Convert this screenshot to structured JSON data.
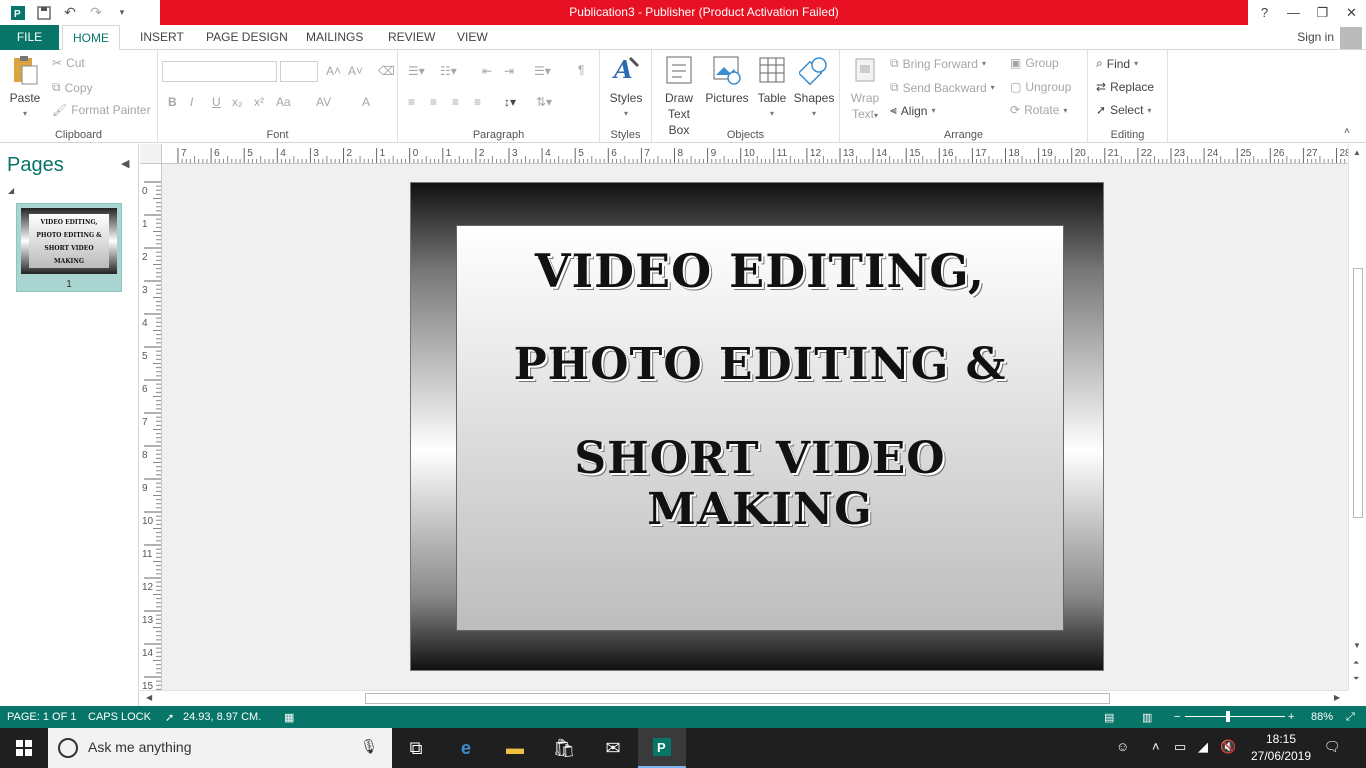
{
  "window": {
    "title": "Publication3 -  Publisher (Product Activation Failed)",
    "help": "?",
    "minimize": "—",
    "restore": "❐",
    "close": "✕",
    "ribbon_options": "?"
  },
  "qat": {
    "app_icon": "publisher-icon",
    "save": "save-icon",
    "undo": "undo-icon",
    "redo": "redo-icon",
    "customize": "customize-icon"
  },
  "tabs": [
    {
      "label": "FILE"
    },
    {
      "label": "HOME"
    },
    {
      "label": "INSERT"
    },
    {
      "label": "PAGE DESIGN"
    },
    {
      "label": "MAILINGS"
    },
    {
      "label": "REVIEW"
    },
    {
      "label": "VIEW"
    }
  ],
  "account": {
    "sign_in": "Sign in"
  },
  "ribbon": {
    "clipboard": {
      "label": "Clipboard",
      "paste": "Paste",
      "cut": "Cut",
      "copy": "Copy",
      "format_painter": "Format Painter"
    },
    "font": {
      "label": "Font",
      "bold": "B",
      "italic": "I",
      "underline": "U",
      "subscript": "x₂",
      "superscript": "x²",
      "case": "Aa",
      "spacing": "AV",
      "color": "A",
      "grow": "A˄",
      "shrink": "A˅"
    },
    "paragraph": {
      "label": "Paragraph",
      "pilcrow": "¶"
    },
    "styles": {
      "label": "Styles",
      "styles": "Styles"
    },
    "objects": {
      "label": "Objects",
      "draw_text_box": "Draw\nText Box",
      "draw_line1": "Draw",
      "draw_line2": "Text Box",
      "pictures": "Pictures",
      "table": "Table",
      "shapes": "Shapes"
    },
    "arrange": {
      "label": "Arrange",
      "wrap1": "Wrap",
      "wrap2": "Text",
      "bring_forward": "Bring Forward",
      "send_backward": "Send Backward",
      "align": "Align",
      "group": "Group",
      "ungroup": "Ungroup",
      "rotate": "Rotate"
    },
    "editing": {
      "label": "Editing",
      "find": "Find",
      "replace": "Replace",
      "select": "Select"
    }
  },
  "pages_pane": {
    "title": "Pages",
    "thumb_number": "1",
    "thumb_lines": [
      "VIDEO EDITING,",
      "PHOTO EDITING &",
      "SHORT VIDEO MAKING"
    ]
  },
  "ruler": {
    "h": [
      "7",
      "6",
      "5",
      "4",
      "3",
      "2",
      "1",
      "0",
      "1",
      "2",
      "3",
      "4",
      "5",
      "6",
      "7",
      "8",
      "9",
      "10",
      "11",
      "12",
      "13",
      "14",
      "15",
      "16",
      "17",
      "18",
      "19",
      "20",
      "21",
      "22",
      "23",
      "24",
      "25",
      "26",
      "27",
      "28"
    ],
    "v": [
      "0",
      "1",
      "2",
      "3",
      "4",
      "5",
      "6",
      "7",
      "8",
      "9",
      "10",
      "11",
      "12",
      "13",
      "14",
      "15"
    ]
  },
  "document": {
    "line1": "VIDEO EDITING,",
    "line2": "PHOTO EDITING &",
    "line3": "SHORT VIDEO MAKING"
  },
  "status": {
    "page": "PAGE: 1 OF 1",
    "caps": "CAPS LOCK",
    "position": "24.93, 8.97 CM.",
    "zoom": "88%",
    "zoom_minus": "−",
    "zoom_plus": "+"
  },
  "taskbar": {
    "search_placeholder": "Ask me anything",
    "time": "18:15",
    "date": "27/06/2019"
  }
}
